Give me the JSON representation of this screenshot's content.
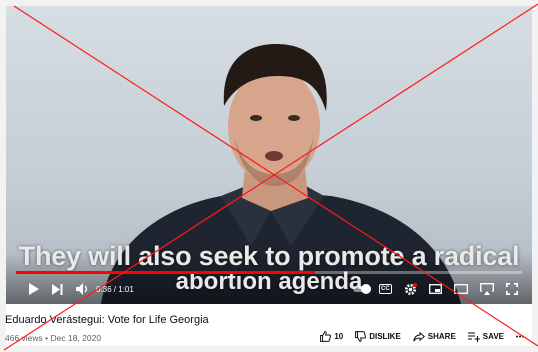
{
  "player": {
    "caption_line1": "They will also seek to promote a radical",
    "caption_line2": "abortion agenda",
    "time_display": "0:36 / 1:01",
    "progress_fraction": 0.59,
    "cc_label": "CC",
    "accent_color": "#ff0000",
    "controls": [
      {
        "name": "play-icon"
      },
      {
        "name": "next-icon"
      },
      {
        "name": "volume-icon"
      },
      {
        "name": "autoplay-toggle-icon"
      },
      {
        "name": "captions-icon"
      },
      {
        "name": "settings-icon"
      },
      {
        "name": "miniplayer-icon"
      },
      {
        "name": "theater-mode-icon"
      },
      {
        "name": "airplay-icon"
      },
      {
        "name": "fullscreen-icon"
      }
    ]
  },
  "video": {
    "title": "Eduardo Verástegui: Vote for Life Georgia",
    "meta": "466 views • Dec 18, 2020"
  },
  "actions": {
    "like_count": "10",
    "dislike_label": "DISLIKE",
    "share_label": "SHARE",
    "save_label": "SAVE",
    "more_icon": "more-icon"
  },
  "overlay": {
    "cross_color": "#ff1a1a"
  }
}
